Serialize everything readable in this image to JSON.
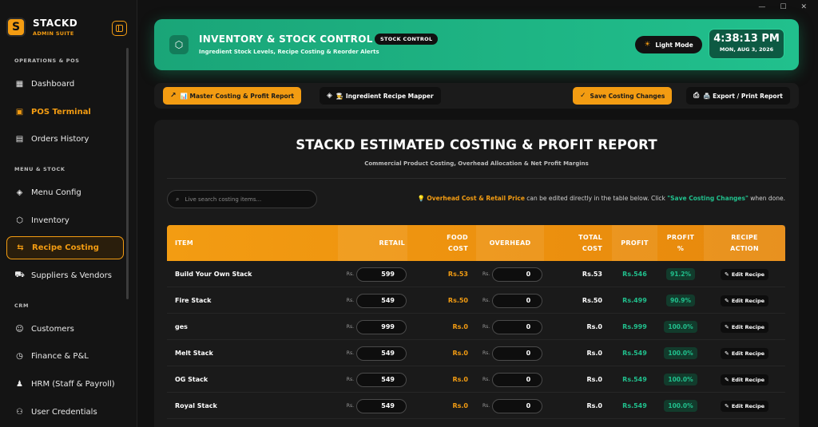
{
  "brand": {
    "name": "STACKD",
    "sub": "ADMIN SUITE",
    "logo": "S"
  },
  "window": {
    "minimize": "—",
    "maximize": "☐",
    "close": "✕"
  },
  "sidebar": {
    "sections": [
      "OPERATIONS & POS",
      "MENU & STOCK",
      "CRM"
    ],
    "items": [
      {
        "label": "Dashboard",
        "icon": "dashboard-icon"
      },
      {
        "label": "POS Terminal",
        "icon": "pos-icon"
      },
      {
        "label": "Orders History",
        "icon": "orders-icon"
      },
      {
        "label": "Menu Config",
        "icon": "layers-icon"
      },
      {
        "label": "Inventory",
        "icon": "box-icon"
      },
      {
        "label": "Recipe Costing",
        "icon": "swap-icon"
      },
      {
        "label": "Suppliers & Vendors",
        "icon": "truck-icon"
      },
      {
        "label": "Customers",
        "icon": "user-icon"
      },
      {
        "label": "Finance & P&L",
        "icon": "finance-icon"
      },
      {
        "label": "HRM (Staff & Payroll)",
        "icon": "staff-icon"
      },
      {
        "label": "User Credentials",
        "icon": "credentials-icon"
      }
    ]
  },
  "header": {
    "title": "INVENTORY & STOCK CONTROL",
    "badge": "STOCK CONTROL",
    "subtitle": "Ingredient Stock Levels, Recipe Costing & Reorder Alerts",
    "light_mode": "Light Mode",
    "time": "4:38:13 PM",
    "date": "MON, AUG 3, 2026"
  },
  "toolbar": {
    "tab_master": "📊 Master Costing & Profit Report",
    "tab_mapper": "👨‍🍳 Ingredient Recipe Mapper",
    "save": "Save Costing Changes",
    "export": "🖨️ Export / Print Report"
  },
  "report": {
    "title": "STACKD ESTIMATED COSTING & PROFIT REPORT",
    "subtitle": "Commercial Product Costing, Overhead Allocation & Net Profit Margins",
    "search_placeholder": "Live search costing items...",
    "hint_prefix": "💡",
    "hint_orange": "Overhead Cost & Retail Price",
    "hint_mid": " can be edited directly in the table below. Click ",
    "hint_green": "\"Save Costing Changes\"",
    "hint_end": " when done."
  },
  "table": {
    "headers": {
      "item": "ITEM",
      "retail": "RETAIL",
      "food1": "FOOD",
      "food2": "COST",
      "overhead": "OVERHEAD",
      "total1": "TOTAL",
      "total2": "COST",
      "profit": "PROFIT",
      "pct1": "PROFIT",
      "pct2": "%",
      "act1": "RECIPE",
      "act2": "ACTION"
    },
    "currency": "Rs.",
    "edit_label": "Edit Recipe",
    "rows": [
      {
        "item": "Build Your Own Stack",
        "retail": "599",
        "food": "Rs.53",
        "overhead": "0",
        "total": "Rs.53",
        "profit": "Rs.546",
        "pct": "91.2%"
      },
      {
        "item": "Fire Stack",
        "retail": "549",
        "food": "Rs.50",
        "overhead": "0",
        "total": "Rs.50",
        "profit": "Rs.499",
        "pct": "90.9%"
      },
      {
        "item": "ges",
        "retail": "999",
        "food": "Rs.0",
        "overhead": "0",
        "total": "Rs.0",
        "profit": "Rs.999",
        "pct": "100.0%"
      },
      {
        "item": "Melt Stack",
        "retail": "549",
        "food": "Rs.0",
        "overhead": "0",
        "total": "Rs.0",
        "profit": "Rs.549",
        "pct": "100.0%"
      },
      {
        "item": "OG Stack",
        "retail": "549",
        "food": "Rs.0",
        "overhead": "0",
        "total": "Rs.0",
        "profit": "Rs.549",
        "pct": "100.0%"
      },
      {
        "item": "Royal Stack",
        "retail": "549",
        "food": "Rs.0",
        "overhead": "0",
        "total": "Rs.0",
        "profit": "Rs.549",
        "pct": "100.0%"
      }
    ]
  },
  "colors": {
    "accent": "#f39c12",
    "success": "#21c08d",
    "banner": "#1aa578"
  }
}
